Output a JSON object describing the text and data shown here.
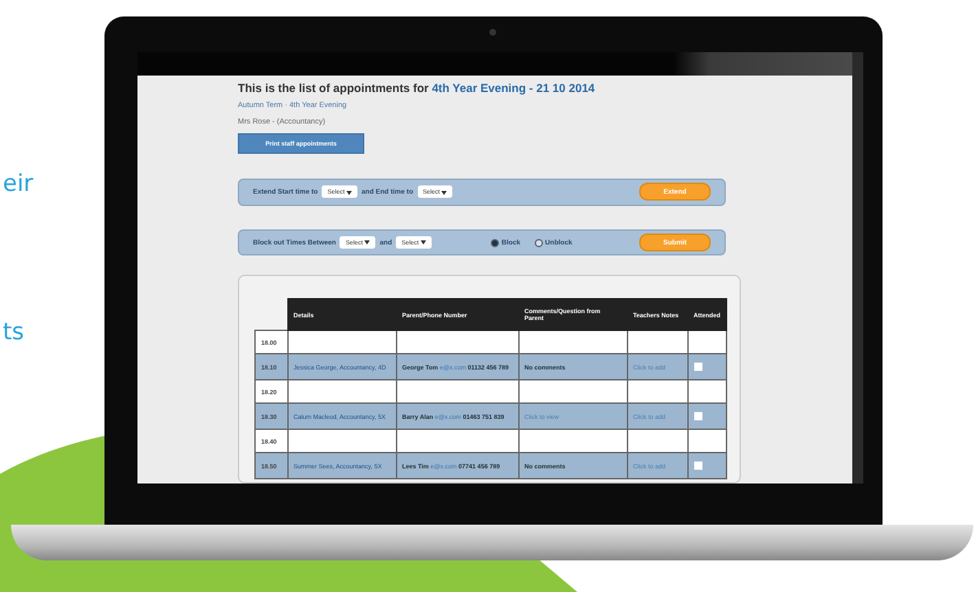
{
  "side_text": [
    {
      "text": "eir"
    },
    {
      "text": "ts"
    }
  ],
  "page": {
    "title_prefix": "This is the list of appointments for",
    "title_event": "4th Year Evening - 21 10 2014",
    "term": "Autumn Term · 4th Year Evening",
    "teacher": "Mrs Rose - (Accountancy)",
    "print_button": "Print staff appointments"
  },
  "extend_panel": {
    "label_start": "Extend Start time to",
    "start_select": "Select",
    "label_end": "and End time to",
    "end_select": "Select",
    "button": "Extend"
  },
  "block_panel": {
    "label_between": "Block out Times Between",
    "from_select": "Select",
    "label_and": "and",
    "to_select": "Select",
    "options": [
      {
        "label": "Block",
        "selected": true
      },
      {
        "label": "Unblock",
        "selected": false
      }
    ],
    "button": "Submit"
  },
  "table": {
    "columns": [
      "Details",
      "Parent/Phone Number",
      "Comments/Question from Parent",
      "Teachers Notes",
      "Attended"
    ],
    "rows": [
      {
        "time": "18.00",
        "kind": "empty"
      },
      {
        "time": "18.10",
        "kind": "booked",
        "details": "Jessica George, Accountancy, 4D",
        "parent": "George Tom",
        "email": "e@x.com",
        "phone": "01132 456 789",
        "comments": "No comments",
        "comments_link": false,
        "notes": "Click to add",
        "checked": false
      },
      {
        "time": "18.20",
        "kind": "empty"
      },
      {
        "time": "18.30",
        "kind": "booked",
        "details": "Calum Macleod, Accountancy, 5X",
        "parent": "Barry Alan",
        "email": "e@x.com",
        "phone": "01463 751 839",
        "comments": "Click to view",
        "comments_link": true,
        "notes": "Click to add",
        "checked": false
      },
      {
        "time": "18.40",
        "kind": "empty"
      },
      {
        "time": "18.50",
        "kind": "booked",
        "details": "Summer Sees, Accountancy, 5X",
        "parent": "Lees Tim",
        "email": "e@x.com",
        "phone": "07741 456 789",
        "comments": "No comments",
        "comments_link": false,
        "notes": "Click to add",
        "checked": false
      }
    ]
  }
}
